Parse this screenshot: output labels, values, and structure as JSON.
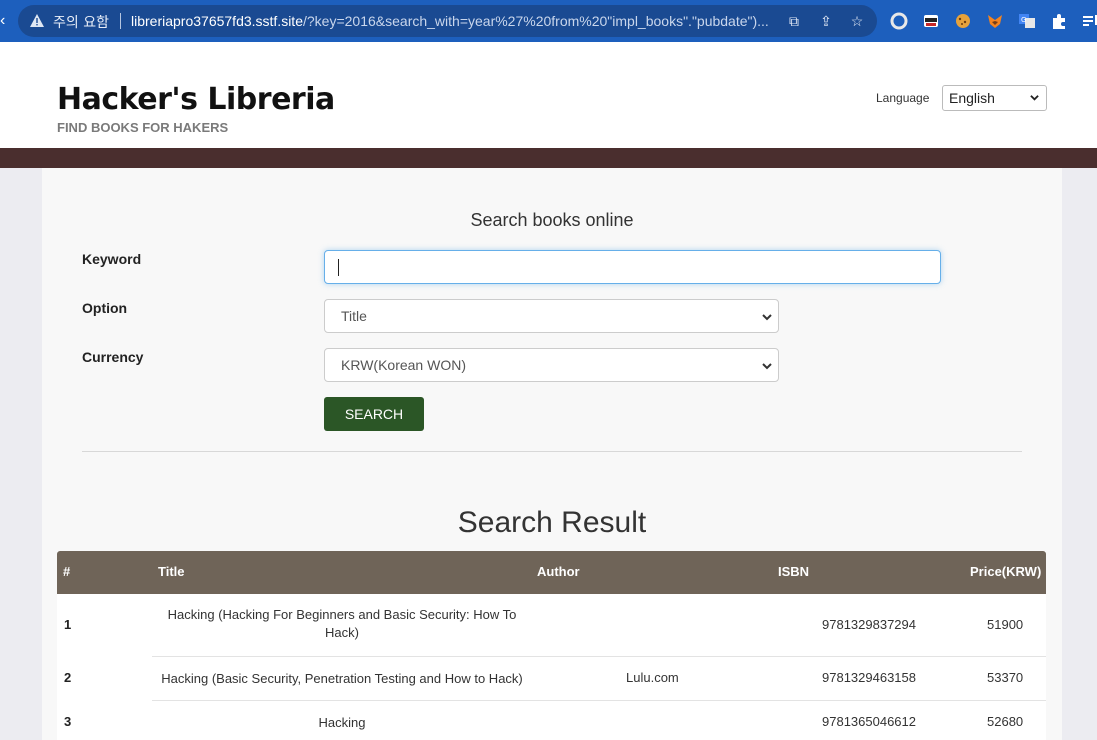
{
  "browser": {
    "security_text": "주의 요함",
    "url_host": "libreriapro37657fd3.sstf.site",
    "url_rest": "/?key=2016&search_with=year%27%20from%20\"impl_books\".\"pubdate\")...",
    "icons": [
      "back-arrow-icon",
      "warning-icon",
      "translate-icon",
      "share-icon",
      "star-icon",
      "circle-icon",
      "spy-extension-icon",
      "cookie-extension-icon",
      "fox-extension-icon",
      "translate-extension-icon",
      "puzzle-icon",
      "playlist-icon"
    ]
  },
  "header": {
    "brand": "Hacker's Libreria",
    "tagline": "FIND BOOKS FOR HAKERS",
    "language_label": "Language",
    "language_value": "English"
  },
  "colors": {
    "band": "#4a2e2e",
    "table_header": "#6f6458",
    "search_button": "#2b5626",
    "browser_bar": "#1d5fbd"
  },
  "search": {
    "title": "Search books online",
    "keyword_label": "Keyword",
    "keyword_value": "",
    "option_label": "Option",
    "option_value": "Title",
    "currency_label": "Currency",
    "currency_value": "KRW(Korean WON)",
    "button_label": "SEARCH"
  },
  "results": {
    "title": "Search Result",
    "columns": [
      "#",
      "Title",
      "Author",
      "ISBN",
      "Price(KRW)"
    ],
    "rows": [
      {
        "num": "1",
        "title": "Hacking (Hacking For Beginners and Basic Security: How To Hack)",
        "author": "",
        "isbn": "9781329837294",
        "price": "51900"
      },
      {
        "num": "2",
        "title": "Hacking (Basic Security, Penetration Testing and How to Hack)",
        "author": "Lulu.com",
        "isbn": "9781329463158",
        "price": "53370"
      },
      {
        "num": "3",
        "title": "Hacking",
        "author": "",
        "isbn": "9781365046612",
        "price": "52680"
      }
    ]
  }
}
